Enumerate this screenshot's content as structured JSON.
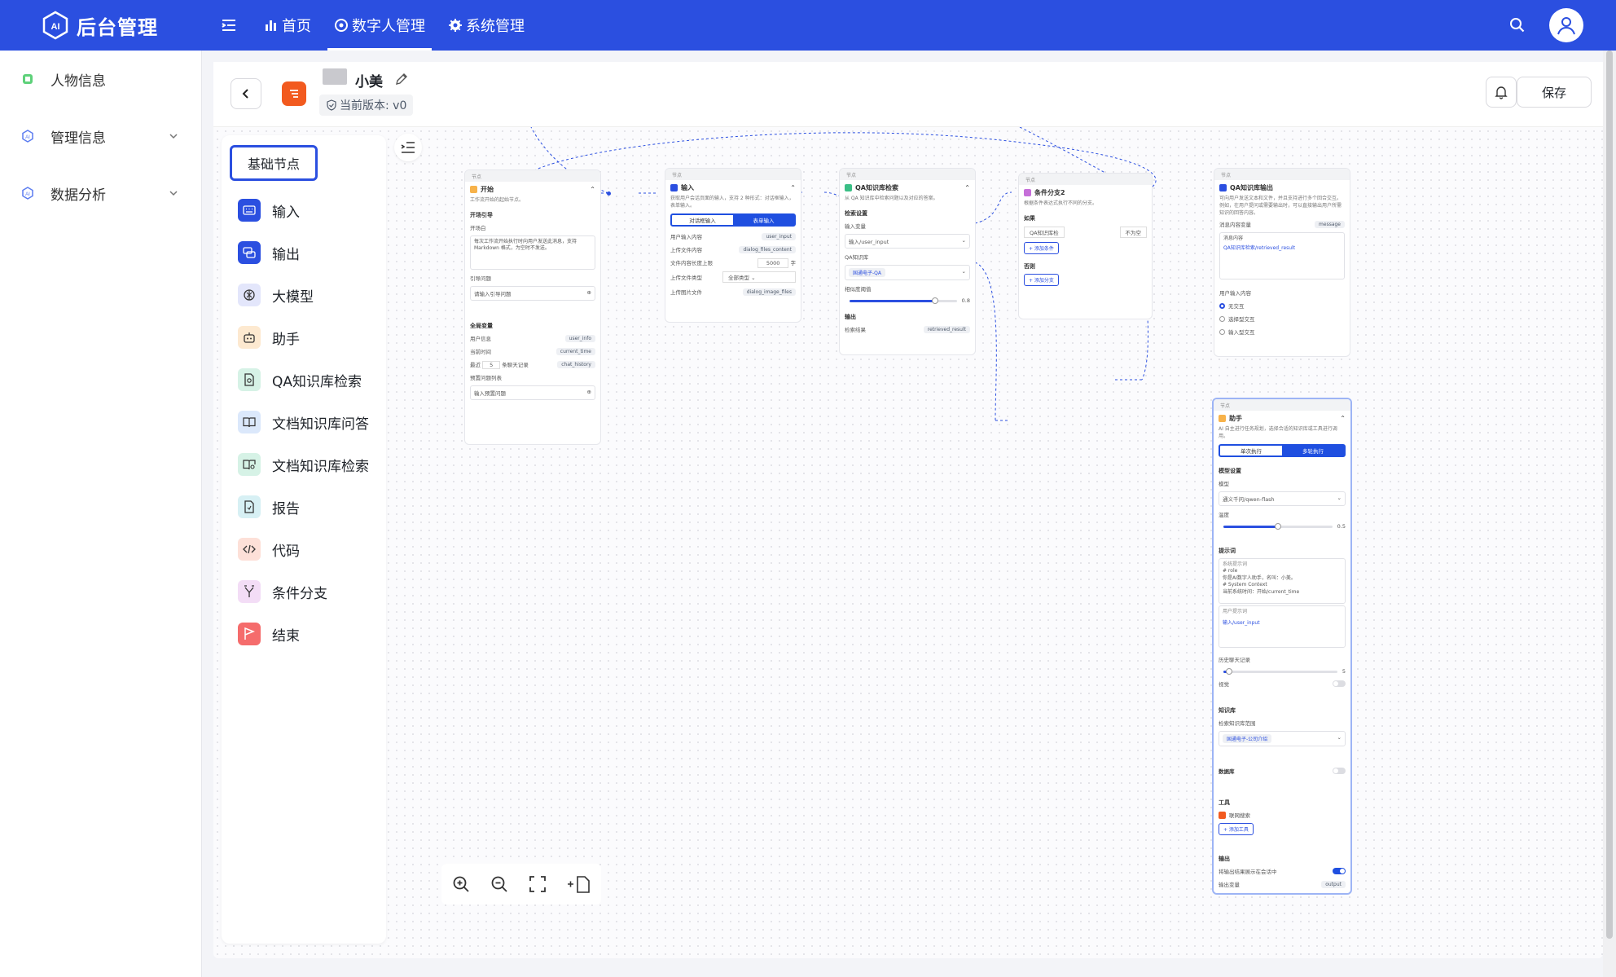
{
  "app": {
    "title": "后台管理"
  },
  "nav": {
    "items": [
      {
        "label": "首页"
      },
      {
        "label": "数字人管理"
      },
      {
        "label": "系统管理"
      }
    ]
  },
  "sidebar": {
    "items": [
      {
        "label": "人物信息"
      },
      {
        "label": "管理信息"
      },
      {
        "label": "数据分析"
      }
    ]
  },
  "header": {
    "title": "小美",
    "version": "当前版本: v0",
    "save_label": "保存"
  },
  "palette": {
    "title": "基础节点",
    "items": [
      {
        "label": "输入",
        "color": "#2b4fe0"
      },
      {
        "label": "输出",
        "color": "#2b4fe0"
      },
      {
        "label": "大模型",
        "color": "#e3e6fb"
      },
      {
        "label": "助手",
        "color": "#fde9d0"
      },
      {
        "label": "QA知识库检索",
        "color": "#d6f2e6"
      },
      {
        "label": "文档知识库问答",
        "color": "#dbe8fb"
      },
      {
        "label": "文档知识库检索",
        "color": "#d6f2e6"
      },
      {
        "label": "报告",
        "color": "#d7f0f4"
      },
      {
        "label": "代码",
        "color": "#fde0d8"
      },
      {
        "label": "条件分支",
        "color": "#f3ddf6"
      },
      {
        "label": "结束",
        "color": "#f56c6c"
      }
    ]
  },
  "nodes": {
    "band": "节点",
    "start": {
      "title": "开始",
      "desc": "工作流开始的起始节点。",
      "guide_section": "开场引导",
      "opening_label": "开场白",
      "opening_text": "每次工作流开始执行时向用户发送此消息，支持 Markdown 格式，为空时不发送。",
      "guide_q_label": "引导问题",
      "guide_q_placeholder": "请输入引导问题",
      "globals_section": "全局变量",
      "vars": [
        {
          "label": "用户信息",
          "tag": "user_info"
        },
        {
          "label": "当前时间",
          "tag": "current_time"
        }
      ],
      "history_prefix": "最近",
      "history_num": "5",
      "history_suffix": "条聊天记录",
      "history_tag": "chat_history",
      "preset_label": "预置问题列表",
      "preset_placeholder": "输入预置问题"
    },
    "input": {
      "title": "输入",
      "desc": "获取用户会话页面的输入，支持 2 种形式：对话框输入，表单输入。",
      "tab1": "对话框输入",
      "tab2": "表单输入",
      "rows": [
        {
          "label": "用户输入内容",
          "tag": "user_input"
        },
        {
          "label": "上传文件内容",
          "tag": "dialog_files_content"
        }
      ],
      "limit_label": "文件内容长度上限",
      "limit_value": "5000",
      "limit_unit": "字",
      "type_label": "上传文件类型",
      "type_value": "全部类型",
      "img_label": "上传图片文件",
      "img_tag": "dialog_image_files"
    },
    "qa": {
      "title": "QA知识库检索",
      "desc": "从 QA 知识库中检索问题以及对应的答案。",
      "settings_section": "检索设置",
      "var_label": "输入变量",
      "var_value": "输入/user_input",
      "kb_label": "QA知识库",
      "kb_chip": "国通电子-QA",
      "sim_label": "相似度阈值",
      "sim_value": "0.8",
      "sim_level": 0.8,
      "out_section": "输出",
      "out_label": "检索结果",
      "out_tag": "retrieved_result"
    },
    "branch": {
      "title": "条件分支2",
      "desc": "根据条件表达式执行不同的分支。",
      "if_label": "如果",
      "cond_sel": "QA知识库检",
      "cond_op": "不为空",
      "add_cond": "+ 添加条件",
      "else_label": "否则",
      "add_branch": "+ 添加分支"
    },
    "qaout": {
      "title": "QA知识库输出",
      "desc": "可向用户发送文本和文件，并且支持进行多个回合交互。例如，在用户提问或需要输出时，可以直接输出用户所需知识的回答内容。",
      "msg_label": "消息内容变量",
      "msg_tag": "message",
      "content_label": "消息内容",
      "content_value": "QA知识库检索/retrieved_result",
      "ui_label": "用户输入内容",
      "opts": [
        "无交互",
        "选择型交互",
        "输入型交互"
      ]
    },
    "assistant": {
      "title": "助手",
      "desc": "AI 自主进行任务规划，选择合适的知识库或工具进行调用。",
      "tab1": "单次执行",
      "tab2": "多轮执行",
      "model_section": "模型设置",
      "model_label": "模型",
      "model_value": "通义千问/qwen-flash",
      "temp_label": "温度",
      "temp_value": "0.5",
      "temp_level": 0.5,
      "prompt_section": "提示词",
      "sys_label": "系统提示词",
      "sys_text": [
        "# role",
        "你是AI数字人助手，名叫：小美。",
        "# System Context",
        "当前系统时间：开始/current_time"
      ],
      "user_label": "用户提示词",
      "user_value": "输入/user_input",
      "hist_label": "历史聊天记录",
      "hist_value": "5",
      "vision_label": "视觉",
      "kb_section": "知识库",
      "kb_scope_label": "检索知识库范围",
      "kb_chip": "国通电子-公司介绍",
      "db_label": "数据库",
      "tools_section": "工具",
      "tool_name": "联网搜索",
      "add_tool": "+ 添加工具",
      "output_section": "输出",
      "show_label": "将输出结果展示在会话中",
      "outvar_label": "输出变量",
      "outvar_tag": "output"
    }
  }
}
